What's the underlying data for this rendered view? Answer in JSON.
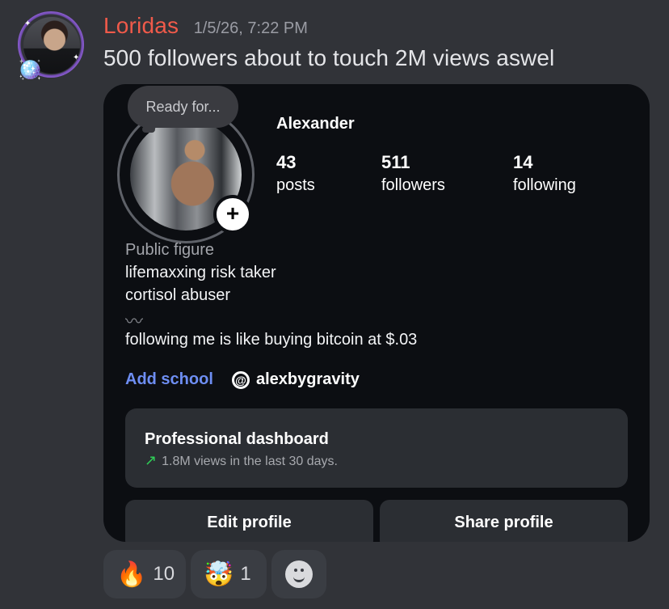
{
  "message": {
    "username": "Loridas",
    "timestamp": "1/5/26, 7:22 PM",
    "text": "500 followers about to touch 2M views aswel"
  },
  "profile_card": {
    "note": "Ready for...",
    "name": "Alexander",
    "stats": [
      {
        "value": "43",
        "label": "posts"
      },
      {
        "value": "511",
        "label": "followers"
      },
      {
        "value": "14",
        "label": "following"
      }
    ],
    "category": "Public figure",
    "bio": [
      "lifemaxxing risk taker",
      "cortisol abuser",
      "following me is like buying bitcoin at $.03"
    ],
    "bio_squiggle": "〰",
    "links": {
      "school": "Add school",
      "threads": "alexbygravity"
    },
    "dashboard": {
      "title": "Professional dashboard",
      "subtitle": "1.8M views in the last 30 days."
    },
    "buttons": {
      "edit": "Edit profile",
      "share": "Share profile"
    }
  },
  "reactions": [
    {
      "emoji": "🔥",
      "count": "10"
    },
    {
      "emoji": "🤯",
      "count": "1"
    }
  ],
  "colors": {
    "background": "#313338",
    "username": "#f05a4a",
    "card": "#0c0e12",
    "link": "#6e8ef3",
    "growth_arrow": "#2fcf57"
  },
  "icons": [
    "add-story-icon",
    "threads-icon",
    "trend-up-icon",
    "add-reaction-icon"
  ]
}
